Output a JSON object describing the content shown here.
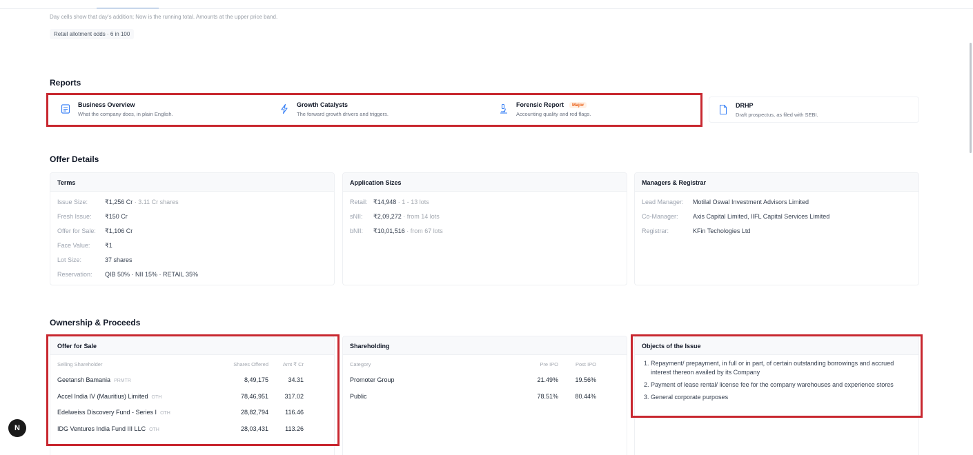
{
  "header": {
    "note": "Day cells show that day's addition; Now is the running total. Amounts at the upper price band.",
    "allotment_odds": "Retail allotment odds · 6 in 100"
  },
  "reports": {
    "title": "Reports",
    "items": [
      {
        "title": "Business Overview",
        "desc": "What the company does, in plain English.",
        "icon": "document-icon"
      },
      {
        "title": "Growth Catalysts",
        "desc": "The forward growth drivers and triggers.",
        "icon": "lightning-icon"
      },
      {
        "title": "Forensic Report",
        "badge": "Major",
        "desc": "Accounting quality and red flags.",
        "icon": "microscope-icon"
      },
      {
        "title": "DRHP",
        "desc": "Draft prospectus, as filed with SEBI.",
        "icon": "file-icon"
      }
    ]
  },
  "offer_details": {
    "title": "Offer Details",
    "terms": {
      "title": "Terms",
      "rows": [
        {
          "k": "Issue Size:",
          "v": "₹1,256 Cr",
          "sub": " · 3.11 Cr shares"
        },
        {
          "k": "Fresh Issue:",
          "v": "₹150 Cr",
          "sub": ""
        },
        {
          "k": "Offer for Sale:",
          "v": "₹1,106 Cr",
          "sub": ""
        },
        {
          "k": "Face Value:",
          "v": "₹1",
          "sub": ""
        },
        {
          "k": "Lot Size:",
          "v": "37 shares",
          "sub": ""
        },
        {
          "k": "Reservation:",
          "v": "QIB 50% · NII 15% · RETAIL 35%",
          "sub": ""
        }
      ]
    },
    "application_sizes": {
      "title": "Application Sizes",
      "rows": [
        {
          "k": "Retail:",
          "v": "₹14,948",
          "sub": " · 1 - 13 lots"
        },
        {
          "k": "sNII:",
          "v": "₹2,09,272",
          "sub": " · from 14 lots"
        },
        {
          "k": "bNII:",
          "v": "₹10,01,516",
          "sub": " · from 67 lots"
        }
      ]
    },
    "managers": {
      "title": "Managers & Registrar",
      "rows": [
        {
          "k": "Lead Manager:",
          "v": "Motilal Oswal Investment Advisors Limited"
        },
        {
          "k": "Co-Manager:",
          "v": "Axis Capital Limited, IIFL Capital Services Limited"
        },
        {
          "k": "Registrar:",
          "v": "KFin Techologies Ltd"
        }
      ]
    }
  },
  "ownership": {
    "title": "Ownership & Proceeds",
    "offer_for_sale": {
      "title": "Offer for Sale",
      "headers": [
        "Selling Shareholder",
        "Shares Offered",
        "Amt ₹ Cr"
      ],
      "rows": [
        {
          "name": "Geetansh Bamania",
          "tag": "PRMTR",
          "shares": "8,49,175",
          "amt": "34.31"
        },
        {
          "name": "Accel India IV (Mauritius) Limited",
          "tag": "OTH",
          "shares": "78,46,951",
          "amt": "317.02"
        },
        {
          "name": "Edelweiss Discovery Fund - Series I",
          "tag": "OTH",
          "shares": "28,82,794",
          "amt": "116.46"
        },
        {
          "name": "IDG Ventures India Fund III LLC",
          "tag": "OTH",
          "shares": "28,03,431",
          "amt": "113.26"
        }
      ]
    },
    "shareholding": {
      "title": "Shareholding",
      "headers": [
        "Category",
        "Pre IPO",
        "Post IPO"
      ],
      "rows": [
        {
          "cat": "Promoter Group",
          "pre": "21.49%",
          "post": "19.56%"
        },
        {
          "cat": "Public",
          "pre": "78.51%",
          "post": "80.44%"
        }
      ]
    },
    "objects": {
      "title": "Objects of the Issue",
      "items": [
        "Repayment/ prepayment, in full or in part, of certain outstanding borrowings and accrued interest thereon availed by its Company",
        "Payment of lease rental/ license fee for the company warehouses and experience stores",
        "General corporate purposes"
      ]
    }
  },
  "misc": {
    "next_badge": "N"
  },
  "colors": {
    "highlight": "#c8272f",
    "accent": "#3b82f6",
    "major_badge": "#ea580c"
  }
}
